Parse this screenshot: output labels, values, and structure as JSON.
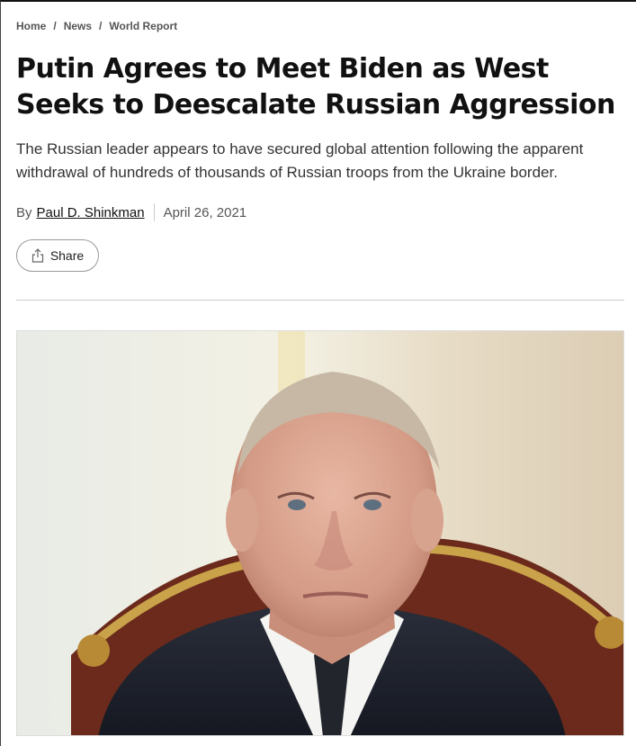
{
  "breadcrumb": {
    "items": [
      "Home",
      "News",
      "World Report"
    ],
    "separator": "/"
  },
  "article": {
    "title": "Putin Agrees to Meet Biden as West Seeks to Deescalate Russian Aggression",
    "deck": "The Russian leader appears to have secured global attention following the apparent withdrawal of hundreds of thousands of Russian troops from the Ukraine border.",
    "byline_prefix": "By",
    "author": "Paul D. Shinkman",
    "date": "April 26, 2021"
  },
  "share": {
    "label": "Share",
    "icon": "share-icon"
  },
  "colors": {
    "text": "#111111",
    "muted": "#555555",
    "divider": "#cccccc"
  }
}
